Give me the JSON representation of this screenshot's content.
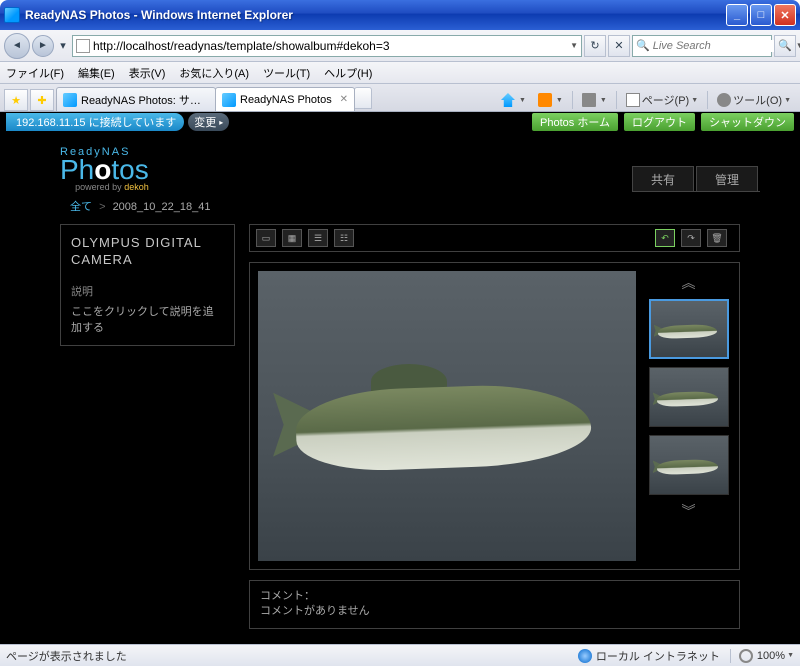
{
  "window": {
    "title": "ReadyNAS Photos - Windows Internet Explorer"
  },
  "nav": {
    "url": "http://localhost/readynas/template/showalbum#dekoh=3",
    "search_placeholder": "Live Search"
  },
  "menubar": {
    "file": "ファイル(F)",
    "edit": "編集(E)",
    "view": "表示(V)",
    "fav": "お気に入り(A)",
    "tools": "ツール(T)",
    "help": "ヘルプ(H)"
  },
  "tabs": [
    {
      "label": "ReadyNAS Photos: サインアッ…",
      "active": false
    },
    {
      "label": "ReadyNAS Photos",
      "active": true
    }
  ],
  "cmdbar": {
    "page": "ページ(P)",
    "tool": "ツール(O)"
  },
  "rn": {
    "conn": "192.168.11.15 に接続しています",
    "change": "変更",
    "btn_home": "Photos ホーム",
    "btn_logout": "ログアウト",
    "btn_shutdown": "シャットダウン",
    "logo_brand": "ReadyNAS",
    "logo_powered": "powered by",
    "logo_dekoh": "dekoh",
    "tab_share": "共有",
    "tab_manage": "管理",
    "crumb_root": "全て",
    "crumb_album": "2008_10_22_18_41",
    "photo_title": "OLYMPUS DIGITAL CAMERA",
    "desc_label": "説明",
    "desc_text": "ここをクリックして説明を追加する",
    "comment_label": "コメント：",
    "comment_text": "コメントがありません"
  },
  "status": {
    "msg": "ページが表示されました",
    "zone": "ローカル イントラネット",
    "zoom": "100%"
  }
}
